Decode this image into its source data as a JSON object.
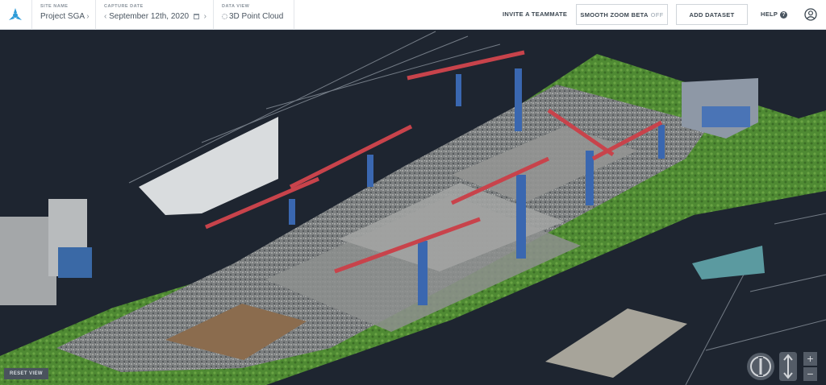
{
  "header": {
    "site": {
      "label": "SITE NAME",
      "value": "Project SGA"
    },
    "capture": {
      "label": "CAPTURE DATE",
      "value": "September 12th, 2020"
    },
    "view": {
      "label": "DATA VIEW",
      "value": "3D Point Cloud"
    },
    "invite_label": "INVITE A TEAMMATE",
    "smooth_zoom_label": "SMOOTH ZOOM BETA",
    "smooth_zoom_state": "OFF",
    "add_dataset_label": "ADD DATASET",
    "help_label": "HELP",
    "help_icon_glyph": "?"
  },
  "viewer": {
    "reset_label": "RESET VIEW",
    "zoom_in_glyph": "+",
    "zoom_out_glyph": "−"
  },
  "colors": {
    "brand": "#2d9bd8",
    "viewport_bg": "#1e2530",
    "header_bg": "#ffffff",
    "header_text": "#3b4650",
    "vegetation": "#4f8a33",
    "crane_red": "#c8434b",
    "crane_blue": "#3a67b0"
  },
  "icons": [
    "logo-icon",
    "chevron-right-icon",
    "chevron-left-icon",
    "calendar-icon",
    "point-cloud-icon",
    "help-icon",
    "user-avatar-icon",
    "orbit-icon",
    "pan-icon",
    "zoom-in-icon",
    "zoom-out-icon"
  ]
}
